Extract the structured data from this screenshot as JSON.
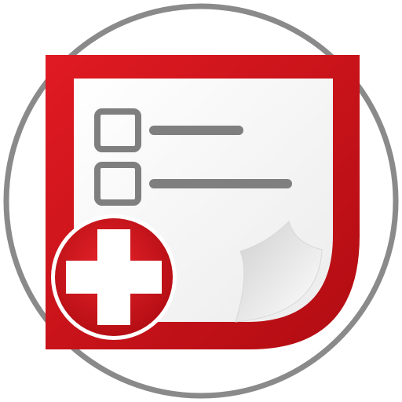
{
  "icon": {
    "name": "checklist-add-app-icon",
    "colors": {
      "ring": "#8a8a8a",
      "frame_red": "#cf1018",
      "frame_red_dark": "#a80a10",
      "paper": "#f7f7f7",
      "paper_shadow": "#d9d9d9",
      "checkbox_gray": "#7f7f7f",
      "plus_white": "#ffffff"
    }
  }
}
